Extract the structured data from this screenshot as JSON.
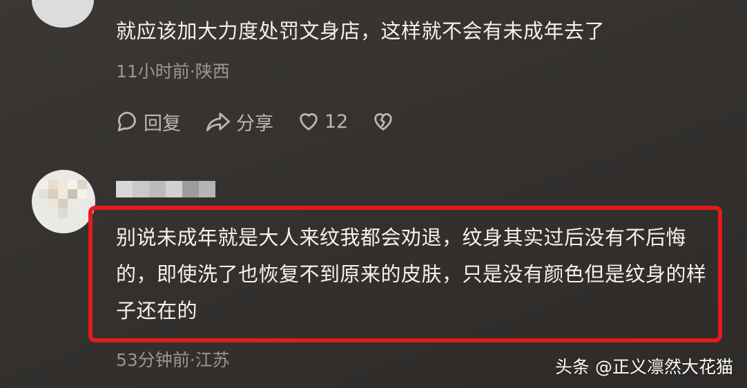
{
  "comment1": {
    "text": "就应该加大力度处罚文身店，这样就不会有未成年去了",
    "meta": "11小时前·陕西",
    "actions": {
      "reply_icon": "comment-bubble-icon",
      "reply_label": "回复",
      "share_icon": "share-arrow-icon",
      "share_label": "分享",
      "like_icon": "heart-icon",
      "like_count": "12",
      "dislike_icon": "broken-heart-icon"
    }
  },
  "comment2": {
    "avatar": "blurred",
    "username": "blurred",
    "text": "别说未成年就是大人来纹我都会劝退，纹身其实过后没有不后悔的，即使洗了也恢复不到原来的皮肤，只是没有颜色但是纹身的样子还在的",
    "meta": "53分钟前·江苏",
    "highlight_color": "#e31b1b"
  },
  "watermark": "头条 @正义凛然大花猫"
}
